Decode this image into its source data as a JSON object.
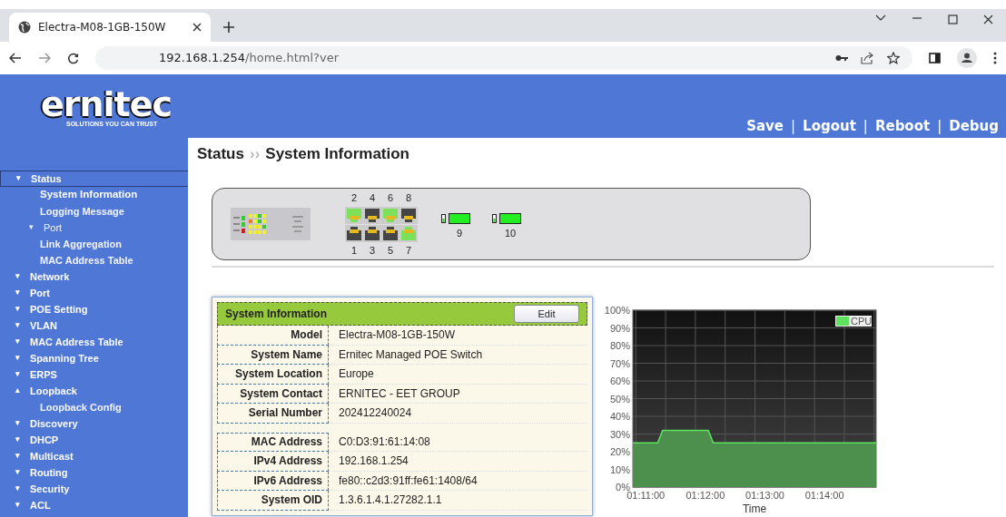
{
  "browser": {
    "tab_title": "Electra-M08-1GB-150W",
    "url_host": "192.168.1.254",
    "url_path": "/home.html?ver"
  },
  "header": {
    "logo_text": "ernitec",
    "tagline": "SOLUTIONS YOU CAN TRUST",
    "links": [
      {
        "kind": "link",
        "label": "Save"
      },
      {
        "kind": "separator",
        "label": "|"
      },
      {
        "kind": "link",
        "label": "Logout"
      },
      {
        "kind": "separator",
        "label": "|"
      },
      {
        "kind": "link",
        "label": "Reboot"
      },
      {
        "kind": "separator",
        "label": "|"
      },
      {
        "kind": "link",
        "label": "Debug"
      }
    ]
  },
  "sidebar": {
    "items": [
      {
        "label": "Status",
        "arrow": "▾",
        "selected": true,
        "children": [
          {
            "label": "System Information",
            "selected": true
          },
          {
            "label": "Logging Message",
            "selected": false
          },
          {
            "label": "Port",
            "arrow": "▾",
            "selected": false
          },
          {
            "label": "Link Aggregation",
            "selected": false
          },
          {
            "label": "MAC Address Table",
            "selected": false
          }
        ]
      },
      {
        "label": "Network",
        "arrow": "▾",
        "selected": false
      },
      {
        "label": "Port",
        "arrow": "▾",
        "selected": false
      },
      {
        "label": "POE Setting",
        "arrow": "▾",
        "selected": false
      },
      {
        "label": "VLAN",
        "arrow": "▾",
        "selected": false
      },
      {
        "label": "MAC Address Table",
        "arrow": "▾",
        "selected": false
      },
      {
        "label": "Spanning Tree",
        "arrow": "▾",
        "selected": false
      },
      {
        "label": "ERPS",
        "arrow": "▾",
        "selected": false
      },
      {
        "label": "Loopback",
        "arrow": "▴",
        "selected": false,
        "children": [
          {
            "label": "Loopback Config",
            "selected": false
          }
        ]
      },
      {
        "label": "Discovery",
        "arrow": "▾",
        "selected": false
      },
      {
        "label": "DHCP",
        "arrow": "▾",
        "selected": false
      },
      {
        "label": "Multicast",
        "arrow": "▾",
        "selected": false
      },
      {
        "label": "Routing",
        "arrow": "▾",
        "selected": false
      },
      {
        "label": "Security",
        "arrow": "▾",
        "selected": false
      },
      {
        "label": "ACL",
        "arrow": "▾",
        "selected": false
      }
    ]
  },
  "breadcrumb": {
    "section": "Status",
    "separator": "››",
    "page": "System Information"
  },
  "switch_panel": {
    "top_ports": [
      {
        "label": "2",
        "link": true
      },
      {
        "label": "4",
        "link": false
      },
      {
        "label": "6",
        "link": true
      },
      {
        "label": "8",
        "link": false
      }
    ],
    "bottom_ports": [
      {
        "label": "1",
        "link": false
      },
      {
        "label": "3",
        "link": false
      },
      {
        "label": "5",
        "link": false
      },
      {
        "label": "7",
        "link": true
      }
    ],
    "sfp_ports": [
      {
        "label": "9",
        "link": true
      },
      {
        "label": "10",
        "link": true
      }
    ]
  },
  "system_information": {
    "title": "System Information",
    "edit_button": "Edit",
    "groups": [
      [
        {
          "label": "Model",
          "value": "Electra-M08-1GB-150W"
        },
        {
          "label": "System Name",
          "value": "Ernitec Managed POE Switch"
        },
        {
          "label": "System Location",
          "value": "Europe"
        },
        {
          "label": "System Contact",
          "value": "ERNITEC - EET GROUP"
        },
        {
          "label": "Serial Number",
          "value": "202412240024"
        }
      ],
      [
        {
          "label": "MAC Address",
          "value": "C0:D3:91:61:14:08"
        },
        {
          "label": "IPv4 Address",
          "value": "192.168.1.254"
        },
        {
          "label": "IPv6 Address",
          "value": "fe80::c2d3:91ff:fe61:1408/64"
        },
        {
          "label": "System OID",
          "value": "1.3.6.1.4.1.27282.1.1"
        }
      ]
    ]
  },
  "cpu_chart": {
    "chart_data": {
      "type": "area",
      "xlabel": "Time",
      "x": [
        4247,
        4272,
        4277,
        4323,
        4328,
        4492
      ],
      "series": [
        {
          "name": "CPU",
          "color": "#5fe35f",
          "values": [
            25,
            25,
            32,
            32,
            25,
            25
          ]
        }
      ],
      "xlim": [
        4247,
        4492
      ],
      "ylim": [
        0,
        100
      ],
      "grid": true,
      "xticks": [
        {
          "value": 4260,
          "label": "01:11:00"
        },
        {
          "value": 4320,
          "label": "01:12:00"
        },
        {
          "value": 4380,
          "label": "01:13:00"
        },
        {
          "value": 4440,
          "label": "01:14:00"
        }
      ],
      "yticks": [
        {
          "value": 0,
          "label": "0%"
        },
        {
          "value": 10,
          "label": "10%"
        },
        {
          "value": 20,
          "label": "20%"
        },
        {
          "value": 30,
          "label": "30%"
        },
        {
          "value": 40,
          "label": "40%"
        },
        {
          "value": 50,
          "label": "50%"
        },
        {
          "value": 60,
          "label": "60%"
        },
        {
          "value": 70,
          "label": "70%"
        },
        {
          "value": 80,
          "label": "80%"
        },
        {
          "value": 90,
          "label": "90%"
        },
        {
          "value": 100,
          "label": "100%"
        }
      ]
    }
  }
}
